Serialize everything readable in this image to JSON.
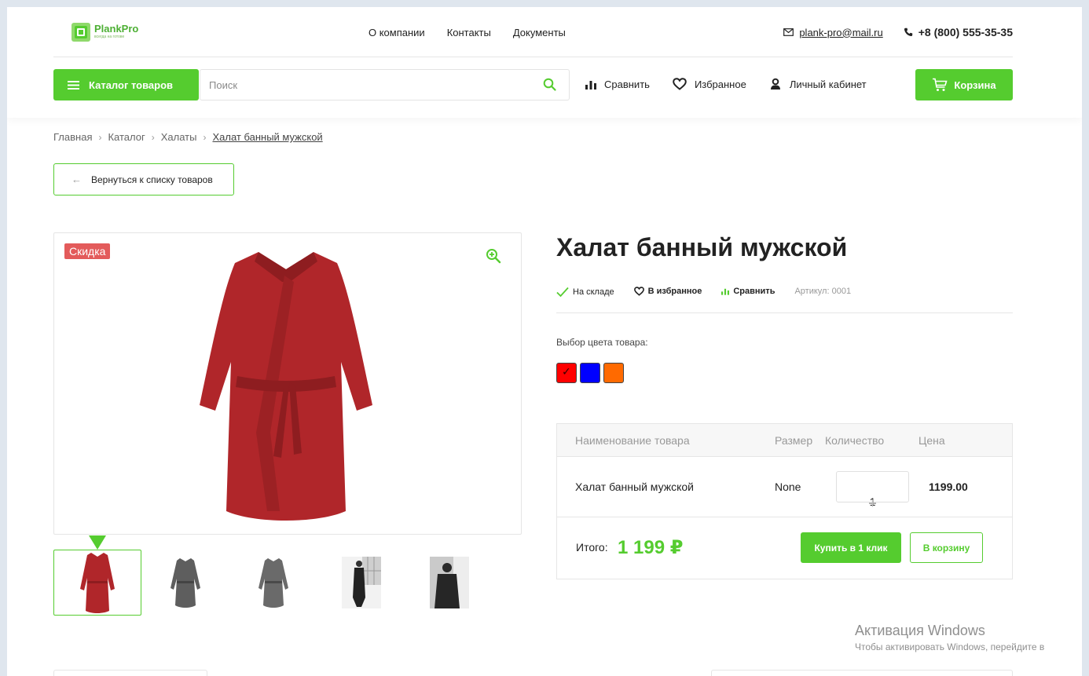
{
  "header": {
    "logo_name": "PlankPro",
    "logo_tagline": "всегда на готове",
    "nav": [
      "О компании",
      "Контакты",
      "Документы"
    ],
    "email": "plank-pro@mail.ru",
    "phone": "+8 (800) 555-35-35",
    "catalog_label": "Каталог товаров",
    "search_placeholder": "Поиск",
    "compare_label": "Сравнить",
    "favorites_label": "Избранное",
    "account_label": "Личный кабинет",
    "cart_label": "Корзина"
  },
  "breadcrumb": [
    "Главная",
    "Каталог",
    "Халаты",
    "Халат банный мужской"
  ],
  "back_label": "Вернуться к списку товаров",
  "product": {
    "badge": "Скидка",
    "title": "Халат банный мужской",
    "stock": "На складе",
    "add_favorite": "В избранное",
    "compare": "Сравнить",
    "sku": "Артикул: 0001",
    "color_label": "Выбор цвета товара:",
    "colors": [
      "#ff0000",
      "#0000ff",
      "#ff6a00"
    ],
    "selected_color": 0,
    "images": [
      "red-robe",
      "gray-robe",
      "gray-robe",
      "model-photo",
      "model-photo"
    ]
  },
  "order": {
    "headers": [
      "Наименование товара",
      "Размер",
      "Количество",
      "Цена"
    ],
    "row": {
      "name": "Халат банный мужской",
      "size": "None",
      "qty": "1",
      "price": "1199.00"
    },
    "total_label": "Итого:",
    "total_value": "1 199 ₽",
    "buy_one_click": "Купить в 1 клик",
    "add_to_cart": "В корзину"
  },
  "windows_activation": {
    "title": "Активация Windows",
    "subtitle": "Чтобы активировать Windows, перейдите в"
  },
  "accent_color": "#55cc2f"
}
